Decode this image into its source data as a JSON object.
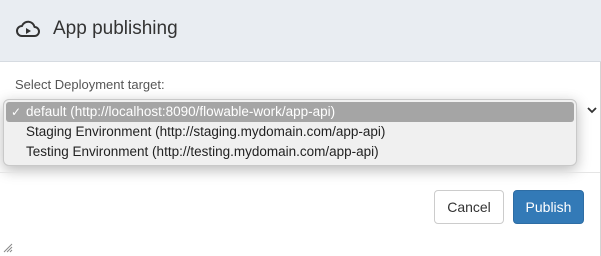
{
  "header": {
    "icon": "cloud-upload-icon",
    "title": "App publishing"
  },
  "form": {
    "label": "Select Deployment target:",
    "dropdown": {
      "selected_index": 0,
      "options": [
        {
          "label": "default (http://localhost:8090/flowable-work/app-api)",
          "checkmark": "✓"
        },
        {
          "label": "Staging Environment (http://staging.mydomain.com/app-api)"
        },
        {
          "label": "Testing Environment (http://testing.mydomain.com/app-api)"
        }
      ]
    }
  },
  "footer": {
    "cancel_label": "Cancel",
    "publish_label": "Publish"
  },
  "colors": {
    "header_bg": "#e9edf2",
    "selected_option_bg": "#a5a5a5",
    "primary_button": "#337ab7"
  }
}
